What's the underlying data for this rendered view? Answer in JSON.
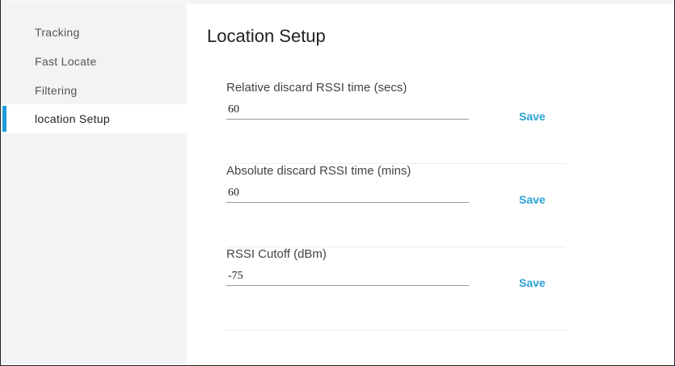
{
  "sidebar": {
    "items": [
      {
        "label": "Tracking"
      },
      {
        "label": "Fast Locate"
      },
      {
        "label": "Filtering"
      },
      {
        "label": "location Setup",
        "active": true
      }
    ]
  },
  "page": {
    "title": "Location Setup"
  },
  "fields": [
    {
      "label": "Relative discard RSSI time (secs)",
      "value": "60",
      "save": "Save"
    },
    {
      "label": "Absolute discard RSSI time (mins)",
      "value": "60",
      "save": "Save"
    },
    {
      "label": "RSSI Cutoff (dBm)",
      "value": "-75",
      "save": "Save"
    }
  ],
  "colors": {
    "accent": "#1e9bd7",
    "save": "#2aa0d8"
  }
}
